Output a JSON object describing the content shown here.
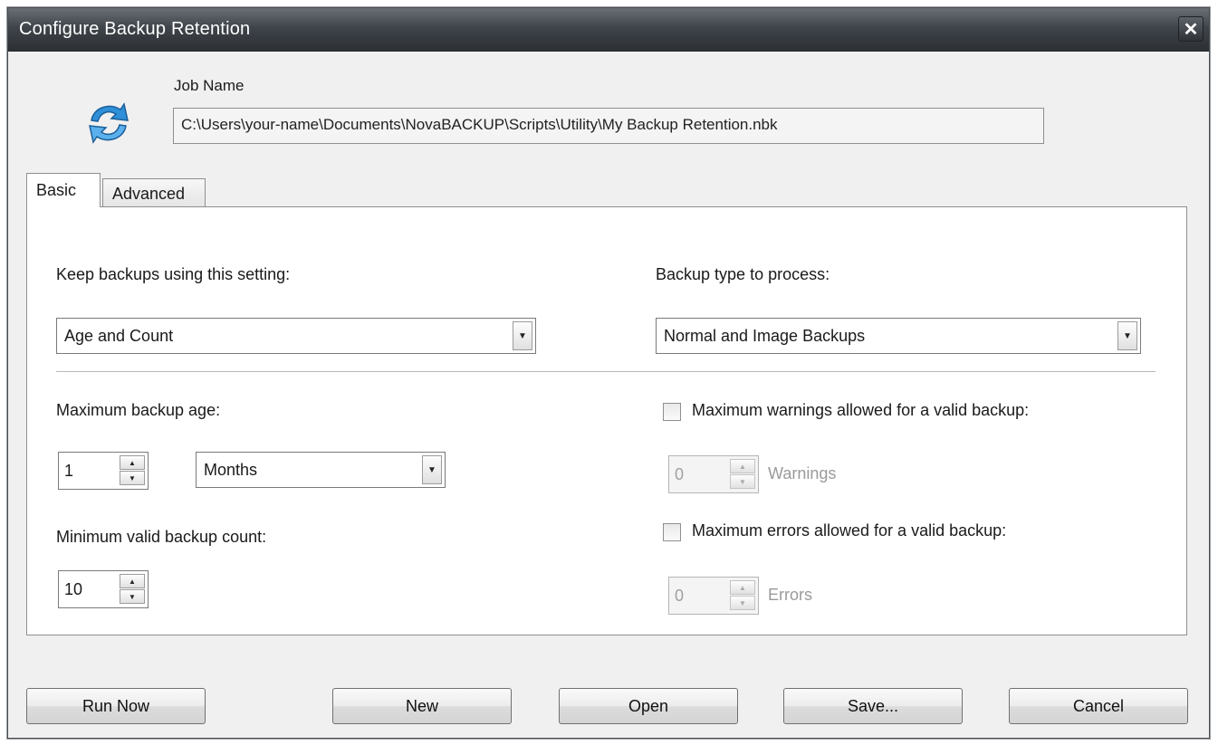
{
  "window": {
    "title": "Configure Backup Retention",
    "close_glyph": "✕"
  },
  "job": {
    "label": "Job Name",
    "path": "C:\\Users\\your-name\\Documents\\NovaBACKUP\\Scripts\\Utility\\My Backup Retention.nbk",
    "icon": "refresh-arrows-icon"
  },
  "tabs": [
    {
      "label": "Basic",
      "selected": true
    },
    {
      "label": "Advanced",
      "selected": false
    }
  ],
  "basic": {
    "keep_label": "Keep backups using this setting:",
    "keep_value": "Age and Count",
    "type_label": "Backup type to process:",
    "type_value": "Normal and Image Backups",
    "max_age_label": "Maximum backup age:",
    "max_age_value": "1",
    "max_age_unit": "Months",
    "min_count_label": "Minimum valid backup count:",
    "min_count_value": "10",
    "max_warnings_label": "Maximum warnings allowed for a valid backup:",
    "max_warnings_checked": false,
    "warnings_value": "0",
    "warnings_unit": "Warnings",
    "max_errors_label": "Maximum errors allowed for a valid backup:",
    "max_errors_checked": false,
    "errors_value": "0",
    "errors_unit": "Errors"
  },
  "buttons": {
    "run_now": "Run Now",
    "new": "New",
    "open": "Open",
    "save": "Save...",
    "cancel": "Cancel"
  },
  "colors": {
    "icon_blue": "#2f8fd8",
    "titlebar": "#3f444a"
  }
}
